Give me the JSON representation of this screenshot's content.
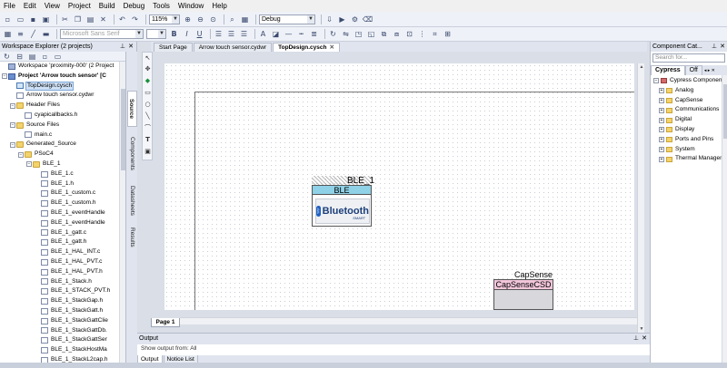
{
  "menu": [
    "File",
    "Edit",
    "View",
    "Project",
    "Build",
    "Debug",
    "Tools",
    "Window",
    "Help"
  ],
  "toolbar": {
    "zoom": "115%",
    "config": "Debug",
    "font": "Microsoft Sans Serif"
  },
  "workspace": {
    "title": "Workspace Explorer (2 projects)",
    "side_tabs": [
      "Source",
      "Components",
      "Datasheets",
      "Results"
    ],
    "tree": [
      {
        "label": "Workspace 'proximity-000' (2 Project",
        "level": 0,
        "icon": "ws",
        "expander": "",
        "bold": false,
        "selected": false
      },
      {
        "label": "Project 'Arrow touch sensor' [C",
        "level": 0,
        "icon": "proj",
        "expander": "−",
        "bold": true,
        "selected": false
      },
      {
        "label": "TopDesign.cysch",
        "level": 1,
        "icon": "sch",
        "expander": "",
        "bold": false,
        "selected": true
      },
      {
        "label": "Arrow touch sensor.cydwr",
        "level": 1,
        "icon": "file",
        "expander": "",
        "bold": false,
        "selected": false
      },
      {
        "label": "Header Files",
        "level": 1,
        "icon": "folder",
        "expander": "−",
        "bold": false,
        "selected": false
      },
      {
        "label": "cyapicallbacks.h",
        "level": 2,
        "icon": "file",
        "expander": "",
        "bold": false,
        "selected": false
      },
      {
        "label": "Source Files",
        "level": 1,
        "icon": "folder",
        "expander": "−",
        "bold": false,
        "selected": false
      },
      {
        "label": "main.c",
        "level": 2,
        "icon": "file",
        "expander": "",
        "bold": false,
        "selected": false
      },
      {
        "label": "Generated_Source",
        "level": 1,
        "icon": "folder",
        "expander": "−",
        "bold": false,
        "selected": false
      },
      {
        "label": "PSoC4",
        "level": 2,
        "icon": "folder",
        "expander": "−",
        "bold": false,
        "selected": false
      },
      {
        "label": "BLE_1",
        "level": 3,
        "icon": "folder",
        "expander": "−",
        "bold": false,
        "selected": false
      },
      {
        "label": "BLE_1.c",
        "level": 4,
        "icon": "file",
        "expander": "",
        "bold": false,
        "selected": false
      },
      {
        "label": "BLE_1.h",
        "level": 4,
        "icon": "file",
        "expander": "",
        "bold": false,
        "selected": false
      },
      {
        "label": "BLE_1_custom.c",
        "level": 4,
        "icon": "file",
        "expander": "",
        "bold": false,
        "selected": false
      },
      {
        "label": "BLE_1_custom.h",
        "level": 4,
        "icon": "file",
        "expander": "",
        "bold": false,
        "selected": false
      },
      {
        "label": "BLE_1_eventHandle",
        "level": 4,
        "icon": "file",
        "expander": "",
        "bold": false,
        "selected": false
      },
      {
        "label": "BLE_1_eventHandle",
        "level": 4,
        "icon": "file",
        "expander": "",
        "bold": false,
        "selected": false
      },
      {
        "label": "BLE_1_gatt.c",
        "level": 4,
        "icon": "file",
        "expander": "",
        "bold": false,
        "selected": false
      },
      {
        "label": "BLE_1_gatt.h",
        "level": 4,
        "icon": "file",
        "expander": "",
        "bold": false,
        "selected": false
      },
      {
        "label": "BLE_1_HAL_INT.c",
        "level": 4,
        "icon": "file",
        "expander": "",
        "bold": false,
        "selected": false
      },
      {
        "label": "BLE_1_HAL_PVT.c",
        "level": 4,
        "icon": "file",
        "expander": "",
        "bold": false,
        "selected": false
      },
      {
        "label": "BLE_1_HAL_PVT.h",
        "level": 4,
        "icon": "file",
        "expander": "",
        "bold": false,
        "selected": false
      },
      {
        "label": "BLE_1_Stack.h",
        "level": 4,
        "icon": "file",
        "expander": "",
        "bold": false,
        "selected": false
      },
      {
        "label": "BLE_1_STACK_PVT.h",
        "level": 4,
        "icon": "file",
        "expander": "",
        "bold": false,
        "selected": false
      },
      {
        "label": "BLE_1_StackGap.h",
        "level": 4,
        "icon": "file",
        "expander": "",
        "bold": false,
        "selected": false
      },
      {
        "label": "BLE_1_StackGatt.h",
        "level": 4,
        "icon": "file",
        "expander": "",
        "bold": false,
        "selected": false
      },
      {
        "label": "BLE_1_StackGattClie",
        "level": 4,
        "icon": "file",
        "expander": "",
        "bold": false,
        "selected": false
      },
      {
        "label": "BLE_1_StackGattDb.",
        "level": 4,
        "icon": "file",
        "expander": "",
        "bold": false,
        "selected": false
      },
      {
        "label": "BLE_1_StackGattSer",
        "level": 4,
        "icon": "file",
        "expander": "",
        "bold": false,
        "selected": false
      },
      {
        "label": "BLE_1_StackHostMa",
        "level": 4,
        "icon": "file",
        "expander": "",
        "bold": false,
        "selected": false
      },
      {
        "label": "BLE_1_StackL2cap.h",
        "level": 4,
        "icon": "file",
        "expander": "",
        "bold": false,
        "selected": false
      }
    ]
  },
  "doc_tabs": [
    {
      "label": "Start Page",
      "active": false
    },
    {
      "label": "Arrow touch sensor.cydwr",
      "active": false
    },
    {
      "label": "TopDesign.cysch",
      "active": true
    }
  ],
  "page_tab": "Page 1",
  "ble": {
    "name": "BLE_1",
    "header": "BLE",
    "logo": "Bluetooth",
    "smart": "SMART"
  },
  "capsense": {
    "name": "CapSense",
    "header": "CapSenseCSD"
  },
  "output": {
    "title": "Output",
    "sub": "Show output from:  All",
    "tabs": [
      {
        "label": "Output",
        "active": true
      },
      {
        "label": "Notice List",
        "active": false
      }
    ]
  },
  "catalog": {
    "title": "Component Cat...",
    "search_placeholder": "Search for...",
    "tabs": [
      {
        "label": "Cypress",
        "active": true
      },
      {
        "label": "Off",
        "active": false
      }
    ],
    "items": [
      {
        "label": "Cypress Component Ca",
        "type": "lib"
      },
      {
        "label": "Analog",
        "type": "folder"
      },
      {
        "label": "CapSense",
        "type": "folder"
      },
      {
        "label": "Communications",
        "type": "folder"
      },
      {
        "label": "Digital",
        "type": "folder"
      },
      {
        "label": "Display",
        "type": "folder"
      },
      {
        "label": "Ports and Pins",
        "type": "folder"
      },
      {
        "label": "System",
        "type": "folder"
      },
      {
        "label": "Thermal Managem",
        "type": "folder"
      }
    ]
  }
}
